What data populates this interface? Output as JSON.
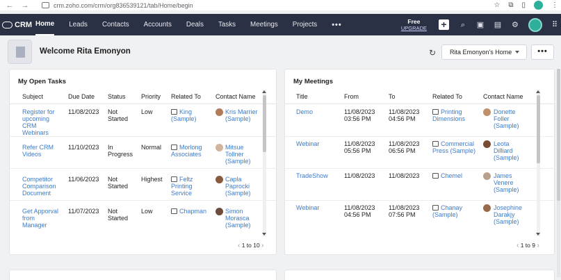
{
  "browser": {
    "url": "crm.zoho.com/crm/org836539121/tab/Home/begin"
  },
  "nav": {
    "brand": "CRM",
    "tabs": [
      "Home",
      "Leads",
      "Contacts",
      "Accounts",
      "Deals",
      "Tasks",
      "Meetings",
      "Projects"
    ],
    "active_tab": "Home",
    "more": "•••",
    "free_label": "Free",
    "upgrade_label": "UPGRADE"
  },
  "welcome": {
    "title": "Welcome Rita Emonyon",
    "home_view": "Rita Emonyon's Home",
    "more": "•••"
  },
  "tasks": {
    "title": "My Open Tasks",
    "columns": [
      "Subject",
      "Due Date",
      "Status",
      "Priority",
      "Related To",
      "Contact Name"
    ],
    "rows": [
      {
        "subject": "Register for upcoming CRM Webinars",
        "due": "11/08/2023",
        "status": "Not Started",
        "priority": "Low",
        "related": "King (Sample)",
        "contact": "Kris Marrier (Sample)"
      },
      {
        "subject": "Refer CRM Videos",
        "due": "11/10/2023",
        "status": "In Progress",
        "priority": "Normal",
        "related": "Morlong Associates",
        "contact": "Mitsue Tollner (Sample)"
      },
      {
        "subject": "Competitor Comparison Document",
        "due": "11/06/2023",
        "status": "Not Started",
        "priority": "Highest",
        "related": "Feltz Printing Service",
        "contact": "Capla Paprocki (Sample)"
      },
      {
        "subject": "Get Apporval from Manager",
        "due": "11/07/2023",
        "status": "Not Started",
        "priority": "Low",
        "related": "Chapman",
        "contact": "Simon Morasca (Sample)"
      }
    ],
    "pager": "1 to 10"
  },
  "meetings": {
    "title": "My Meetings",
    "columns": [
      "Title",
      "From",
      "To",
      "Related To",
      "Contact Name"
    ],
    "rows": [
      {
        "title": "Demo",
        "from": "11/08/2023 03:56 PM",
        "to": "11/08/2023 04:56 PM",
        "related": "Printing Dimensions",
        "contact": "Donette Foller (Sample)"
      },
      {
        "title": "Webinar",
        "from": "11/08/2023 05:56 PM",
        "to": "11/08/2023 06:56 PM",
        "related": "Commercial Press (Sample)",
        "contact": "Leota Dilliard (Sample)"
      },
      {
        "title": "TradeShow",
        "from": "11/08/2023",
        "to": "11/08/2023",
        "related": "Chemel",
        "contact": "James Venere (Sample)"
      },
      {
        "title": "Webinar",
        "from": "11/08/2023 04:56 PM",
        "to": "11/08/2023 07:56 PM",
        "related": "Chanay (Sample)",
        "contact": "Josephine Darakjy (Sample)"
      }
    ],
    "pager": "1 to 9"
  },
  "colors": {
    "nav_bg": "#2b3145",
    "link": "#3d7ccd",
    "accent": "#2eaf9b"
  },
  "icons": [
    "back-arrow-icon",
    "forward-arrow-icon",
    "site-info-icon",
    "star-icon",
    "extension-icon",
    "sidebar-icon",
    "profile-icon",
    "kebab-icon",
    "crm-logo-icon",
    "plus-icon",
    "search-icon",
    "calendar-icon",
    "bag-icon",
    "gear-icon",
    "apps-grid-icon",
    "refresh-icon",
    "building-icon"
  ]
}
